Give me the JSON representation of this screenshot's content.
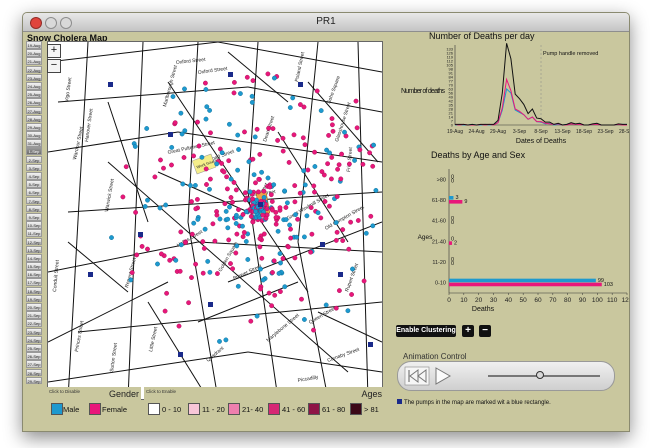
{
  "window": {
    "title": "PR1"
  },
  "map": {
    "title": "Snow Cholera Map",
    "zoom_in": "+",
    "zoom_out": "−",
    "streets": [
      "Oxford Street",
      "Soho Square",
      "Wardour Street",
      "Dean Street",
      "Broad Street",
      "Golden Square",
      "Regent Street",
      "Marlborough Street",
      "Conduit Street",
      "Oxford Street",
      "Poland Street",
      "Berwick Street",
      "Great Windmill Street",
      "Queen Street",
      "Brewer Street",
      "Old Compton Street",
      "Frith Street",
      "Hanover Street",
      "Little Street",
      "Holles Street",
      "Princes Street",
      "Piccadilly",
      "Warwick Street",
      "Quadrant",
      "Vigo Street",
      "Great Pulteney Street",
      "Carnaby Street",
      "Rupert Street",
      "Glasshouse Street",
      "Marylebone Street",
      "Broad Street",
      "Sutton Street"
    ],
    "brewery_label": "Work house",
    "dates": [
      "19-Aug",
      "20-Aug",
      "21-Aug",
      "22-Aug",
      "23-Aug",
      "24-Aug",
      "25-Aug",
      "26-Aug",
      "27-Aug",
      "28-Aug",
      "29-Aug",
      "30-Aug",
      "31-Aug",
      "1-Sep",
      "2-Sep",
      "3-Sep",
      "4-Sep",
      "5-Sep",
      "6-Sep",
      "7-Sep",
      "8-Sep",
      "9-Sep",
      "10-Sep",
      "11-Sep",
      "12-Sep",
      "13-Sep",
      "14-Sep",
      "15-Sep",
      "16-Sep",
      "17-Sep",
      "18-Sep",
      "19-Sep",
      "20-Sep",
      "21-Sep",
      "22-Sep",
      "23-Sep",
      "24-Sep",
      "25-Sep",
      "26-Sep",
      "27-Sep",
      "28-Sep",
      "29-Sep"
    ],
    "selected_date_index": 13
  },
  "gender_legend": {
    "hint": "Click to Disable",
    "title": "Gender",
    "items": [
      {
        "label": "Male",
        "color": "#1d99cf"
      },
      {
        "label": "Female",
        "color": "#e8177a"
      }
    ]
  },
  "age_legend": {
    "hint": "Click to Enable",
    "title": "Ages",
    "items": [
      {
        "label": "0 - 10",
        "color": "#ffffff"
      },
      {
        "label": "11 - 20",
        "color": "#f8c6d8"
      },
      {
        "label": "21- 40",
        "color": "#ee7fae"
      },
      {
        "label": "41 - 60",
        "color": "#d62874"
      },
      {
        "label": "61 - 80",
        "color": "#8e1446"
      },
      {
        "label": "> 81",
        "color": "#3c0818"
      }
    ]
  },
  "chart_data": [
    {
      "type": "line",
      "title": "Number of Deaths per day",
      "xlabel": "Dates of Deaths",
      "ylabel": "Number of deaths",
      "annotation": "Pump handle removed",
      "x_tick_labels": [
        "19-Aug",
        "24-Aug",
        "29-Aug",
        "3-Sep",
        "8-Sep",
        "13-Sep",
        "18-Sep",
        "23-Sep",
        "28-Sep"
      ],
      "y_tick_labels": [
        "0",
        "7",
        "14",
        "21",
        "28",
        "35",
        "42",
        "49",
        "56",
        "63",
        "70",
        "77",
        "84",
        "91",
        "98",
        "105",
        "112",
        "119",
        "126",
        "133"
      ],
      "ylim": [
        0,
        140
      ],
      "series": [
        {
          "name": "total",
          "color": "#111111",
          "values": [
            1,
            1,
            1,
            0,
            1,
            0,
            1,
            1,
            1,
            1,
            8,
            56,
            143,
            116,
            54,
            46,
            36,
            20,
            28,
            12,
            11,
            5,
            5,
            1,
            3,
            0,
            1,
            4,
            2,
            3,
            0,
            0,
            2,
            3,
            0,
            0,
            0,
            0,
            2,
            1,
            1
          ]
        },
        {
          "name": "female",
          "color": "#e8177a",
          "values": [
            1,
            0,
            1,
            0,
            0,
            0,
            1,
            0,
            1,
            0,
            4,
            30,
            80,
            60,
            28,
            24,
            18,
            10,
            14,
            6,
            6,
            3,
            2,
            1,
            2,
            0,
            0,
            2,
            1,
            1,
            0,
            0,
            1,
            1,
            0,
            0,
            0,
            0,
            1,
            0,
            0
          ]
        },
        {
          "name": "male",
          "color": "#1d99cf",
          "values": [
            0,
            1,
            0,
            0,
            1,
            0,
            0,
            1,
            0,
            1,
            4,
            26,
            63,
            56,
            26,
            22,
            18,
            10,
            14,
            6,
            5,
            2,
            3,
            0,
            1,
            0,
            1,
            2,
            1,
            2,
            0,
            0,
            1,
            2,
            0,
            0,
            0,
            0,
            1,
            1,
            1
          ]
        }
      ]
    },
    {
      "type": "bar",
      "title": "Deaths by Age and Sex",
      "xlabel": "Deaths",
      "ylabel": "Ages",
      "categories": [
        ">80",
        "61-80",
        "41-60",
        "21-40",
        "11-20",
        "0-10"
      ],
      "xlim": [
        0,
        120
      ],
      "x_tick_labels": [
        "0",
        "10",
        "20",
        "30",
        "40",
        "50",
        "60",
        "70",
        "80",
        "90",
        "100",
        "110",
        "120"
      ],
      "series": [
        {
          "name": "Male",
          "color": "#1d99cf",
          "values": [
            0,
            3,
            0,
            0,
            0,
            99
          ]
        },
        {
          "name": "Female",
          "color": "#e8177a",
          "values": [
            0,
            9,
            0,
            2,
            0,
            103
          ]
        }
      ]
    }
  ],
  "controls": {
    "enable_clustering": "Enable Clustering",
    "plus": "+",
    "minus": "−",
    "animation_label": "Animation Control",
    "slider_value": 0.46
  },
  "footnote": "The pumps in the map are marked wit a blue rectangle."
}
